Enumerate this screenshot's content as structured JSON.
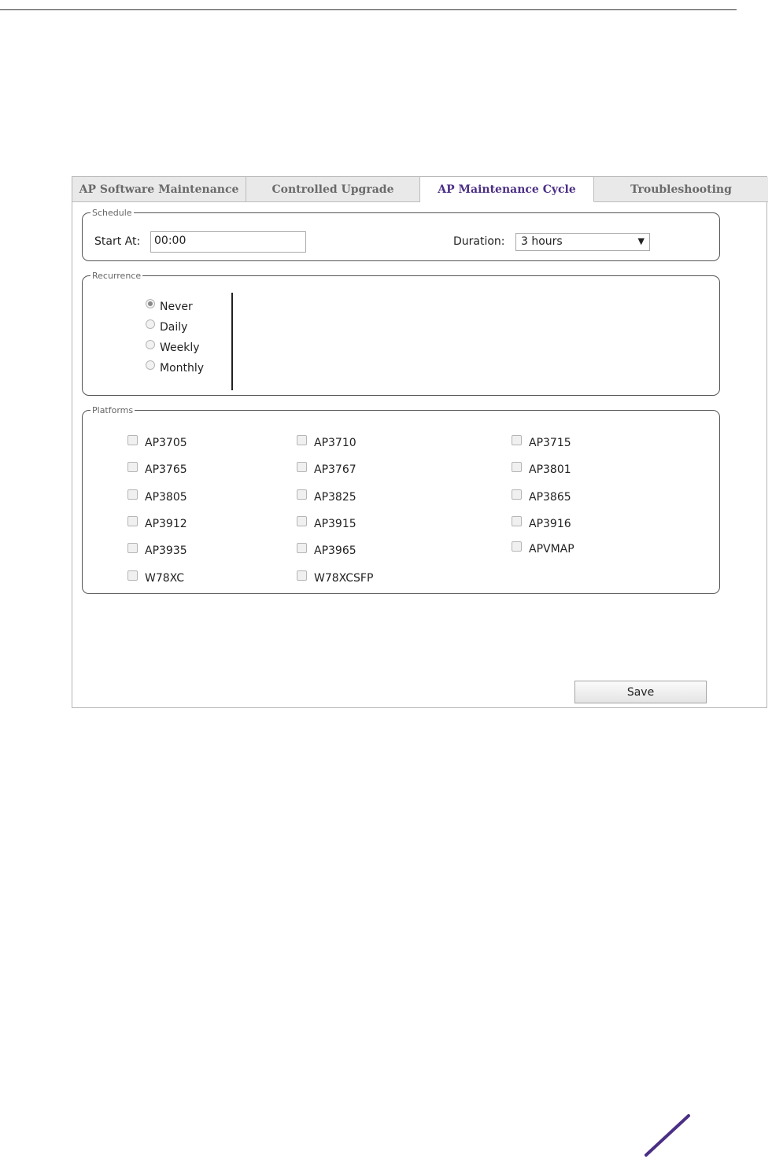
{
  "tabs": [
    {
      "label": "AP Software Maintenance",
      "active": false
    },
    {
      "label": "Controlled Upgrade",
      "active": false
    },
    {
      "label": "AP Maintenance Cycle",
      "active": true
    },
    {
      "label": "Troubleshooting",
      "active": false
    }
  ],
  "schedule": {
    "legend": "Schedule",
    "start_label": "Start At:",
    "start_value": "00:00",
    "duration_label": "Duration:",
    "duration_value": "3 hours"
  },
  "recurrence": {
    "legend": "Recurrence",
    "options": [
      {
        "label": "Never",
        "checked": true
      },
      {
        "label": "Daily",
        "checked": false
      },
      {
        "label": "Weekly",
        "checked": false
      },
      {
        "label": "Monthly",
        "checked": false
      }
    ]
  },
  "platforms": {
    "legend": "Platforms",
    "items": [
      "AP3705",
      "AP3710",
      "AP3715",
      "AP3765",
      "AP3767",
      "AP3801",
      "AP3805",
      "AP3825",
      "AP3865",
      "AP3912",
      "AP3915",
      "AP3916",
      "AP3935",
      "AP3965",
      "APVMAP",
      "W78XC",
      "W78XCSFP"
    ]
  },
  "actions": {
    "save_label": "Save"
  },
  "colors": {
    "active_tab_text": "#4b2f85",
    "brand_mark": "#4b2f85"
  }
}
